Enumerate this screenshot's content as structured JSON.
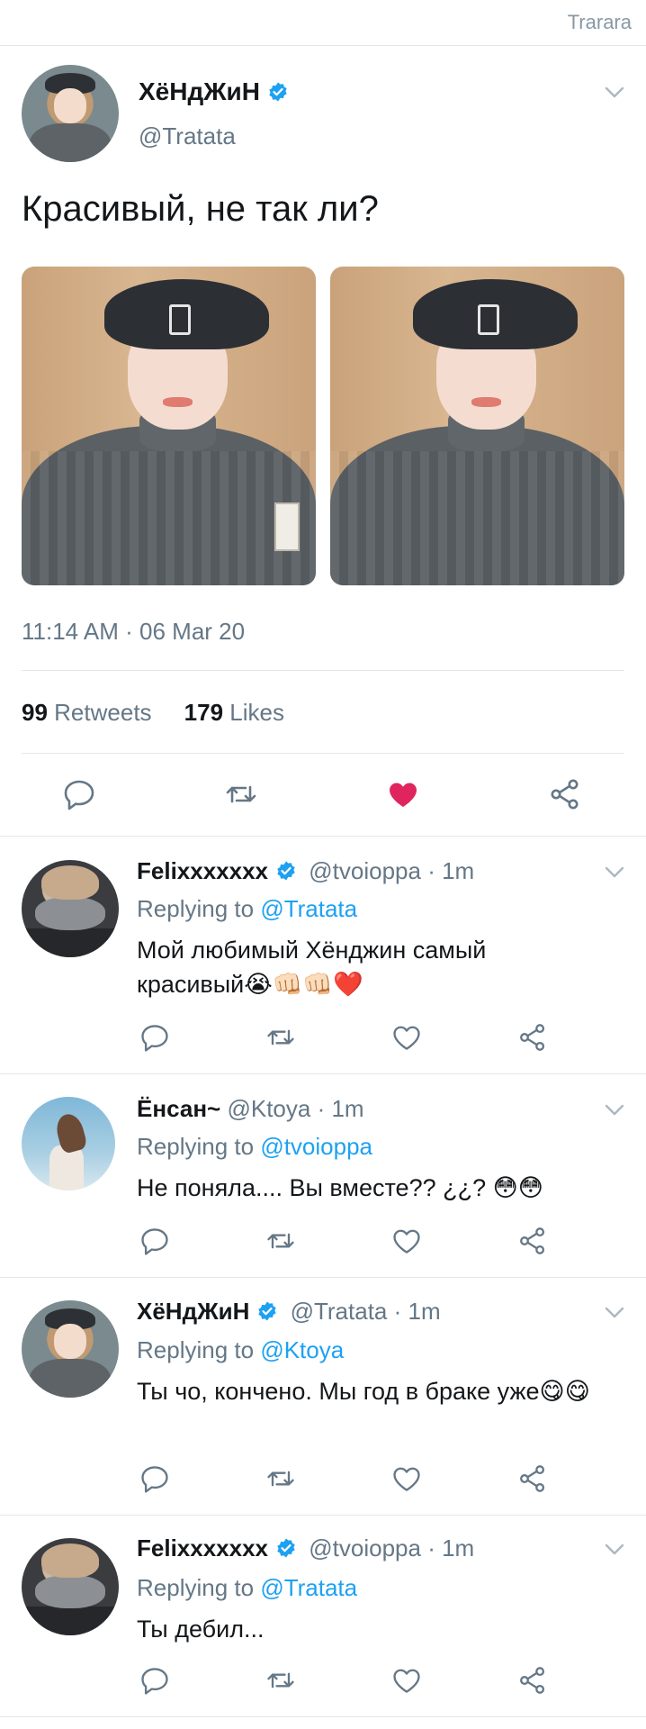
{
  "top_bar": {
    "brand": "Trarara"
  },
  "main_tweet": {
    "author_name": "ХёНдЖиН",
    "author_handle": "@Tratata",
    "text": "Красивый, не так ли?",
    "timestamp": "11:14 AM · 06 Mar 20",
    "retweets_count": "99",
    "retweets_label": "Retweets",
    "likes_count": "179",
    "likes_label": "Likes",
    "liked": true
  },
  "icons": {
    "reply": "reply-icon",
    "retweet": "retweet-icon",
    "like": "heart-icon",
    "share": "share-icon",
    "verified": "verified-badge-icon",
    "menu": "chevron-down-icon"
  },
  "colors": {
    "accent": "#1da1f2",
    "like": "#e0245e",
    "muted": "#657786",
    "text": "#14171a"
  },
  "replies": [
    {
      "author_name": "Felixxxxxxx",
      "verified": true,
      "author_handle": "@tvoioppa",
      "time": "· 1m",
      "replying_label": "Replying to",
      "replying_to": "@Tratata",
      "text_line1": "Мой любимый Хёнджин самый",
      "text_line2": "красивый",
      "emojis": "😭👊🏻👊🏻❤️"
    },
    {
      "author_name": "Ёнсан~",
      "verified": false,
      "author_handle": "@Ktoya",
      "time": "· 1m",
      "replying_label": "Replying to",
      "replying_to": "@tvoioppa",
      "text_line1": "Не поняла.... Вы вместе?? ¿¿?",
      "emojis": "😳😳"
    },
    {
      "author_name": "ХёНдЖиН",
      "verified": true,
      "author_handle": "@Tratata",
      "time": "· 1m",
      "replying_label": "Replying to",
      "replying_to": "@Ktoya",
      "text_line1": "Ты чо, кончено. Мы год в браке уже",
      "emojis": "😋😋"
    },
    {
      "author_name": "Felixxxxxxx",
      "verified": true,
      "author_handle": "@tvoioppa",
      "time": "· 1m",
      "replying_label": "Replying to",
      "replying_to": "@Tratata",
      "text_line1": "Ты дебил..."
    }
  ]
}
